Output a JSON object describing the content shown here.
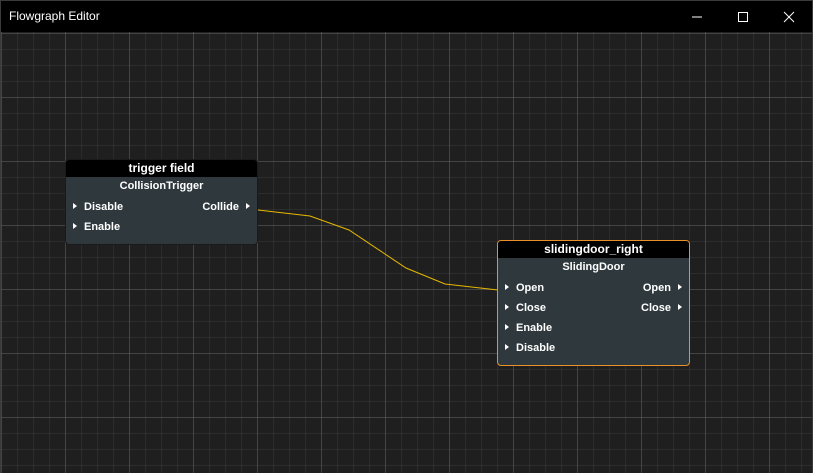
{
  "window": {
    "title": "Flowgraph Editor",
    "controls": [
      "minimize",
      "maximize",
      "close"
    ]
  },
  "colors": {
    "background": "#1f1f1f",
    "node_body": "#2f393d",
    "node_header": "#000000",
    "selected_border": "#e8902a",
    "link": "#e6b800"
  },
  "nodes": [
    {
      "title": "trigger field",
      "class": "CollisionTrigger",
      "selected": false,
      "inputs": [
        "Disable",
        "Enable"
      ],
      "outputs": [
        "Collide"
      ]
    },
    {
      "title": "slidingdoor_right",
      "class": "SlidingDoor",
      "selected": true,
      "inputs": [
        "Open",
        "Close",
        "Enable",
        "Disable"
      ],
      "outputs": [
        "Open",
        "Close"
      ]
    }
  ],
  "links": [
    {
      "from_node": "trigger field",
      "from_port": "Collide",
      "to_node": "slidingdoor_right",
      "to_port": "Open"
    }
  ]
}
